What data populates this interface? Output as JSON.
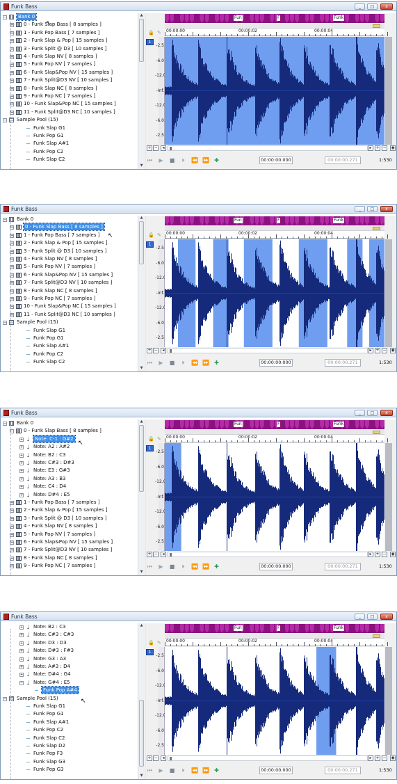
{
  "window": {
    "title": "Funk Bass",
    "min": "_",
    "max": "□",
    "close": "x"
  },
  "tree": {
    "bank": "Bank 0",
    "pool": "Sample Pool (15)"
  },
  "presets": [
    "0 - Funk Slap Bass [ 8 samples ]",
    "1 - Funk Pop Bass [ 7 samples ]",
    "2 - Funk Slap & Pop [ 15 samples ]",
    "3 - Funk Split @ D3 [ 10 samples ]",
    "4 - Funk Slap     NV [ 8 samples ]",
    "5 - Funk Pop      NV [ 7 samples ]",
    "6 - Funk Slap&Pop NV [ 15 samples ]",
    "7 - Funk Split@D3 NV [ 10 samples ]",
    "8 - Funk Slap     NC [ 8 samples ]",
    "9 - Funk Pop      NC [ 7 samples ]",
    "10 - Funk Slap&Pop NC [ 15 samples ]",
    "11 - Funk Split@D3 NC [ 10 samples ]"
  ],
  "notes_a": [
    "Note: C-1 : G#2",
    "Note: A2 : A#2",
    "Note: B2 : C3",
    "Note: C#3 : D#3",
    "Note: E3 : G#3",
    "Note: A3 : B3",
    "Note: C4 : D4",
    "Note: D#4 : E5"
  ],
  "notes_b": [
    "Note: B2 : C3",
    "Note: C#3 : C#3",
    "Note: D3 : D3",
    "Note: D#3 : F#3",
    "Note: G3 : A3",
    "Note: A#3 : D4",
    "Note: D#4 : G4",
    "Note: G#4 : E5"
  ],
  "sample_pool_a": [
    "Funk Slap G1",
    "Funk Pop G1",
    "Funk Slap A#1",
    "Funk Pop C2",
    "Funk Slap C2"
  ],
  "sample_pool_b": [
    "Funk Slap G1",
    "Funk Pop G1",
    "Funk Slap A#1",
    "Funk Pop C2",
    "Funk Slap C2",
    "Funk Slap D2",
    "Funk Pop F3",
    "Funk Slap G3",
    "Funk Pop G3"
  ],
  "selected_sample": "Funk Pop A#4",
  "keyboard_labels": [
    "Fun",
    "F",
    "Funk"
  ],
  "ruler": {
    "t0": "00:00:00",
    "t1": "00:00:02",
    "t2": "00:00:04"
  },
  "db_labels": [
    "-2.5",
    "-6.0",
    "-12.0",
    "-Inf.",
    "-12.0",
    "-6.0",
    "-2.5"
  ],
  "channel": "1",
  "transport": {
    "pos": "00:00:00.000",
    "len": "00:00:00.271",
    "zoom": "1:530"
  },
  "panels": [
    {
      "selection": "whole",
      "wave_color": "#3a68c4"
    },
    {
      "selection": "zones",
      "zones": [
        [
          0.06,
          0.14
        ],
        [
          0.22,
          0.29
        ],
        [
          0.36,
          0.49
        ],
        [
          0.61,
          0.74
        ],
        [
          0.83,
          0.9
        ],
        [
          0.93,
          1.0
        ]
      ]
    },
    {
      "selection": "first",
      "zones": [
        [
          0.0,
          0.075
        ]
      ]
    },
    {
      "selection": "single",
      "zones": [
        [
          0.69,
          0.78
        ]
      ]
    }
  ]
}
